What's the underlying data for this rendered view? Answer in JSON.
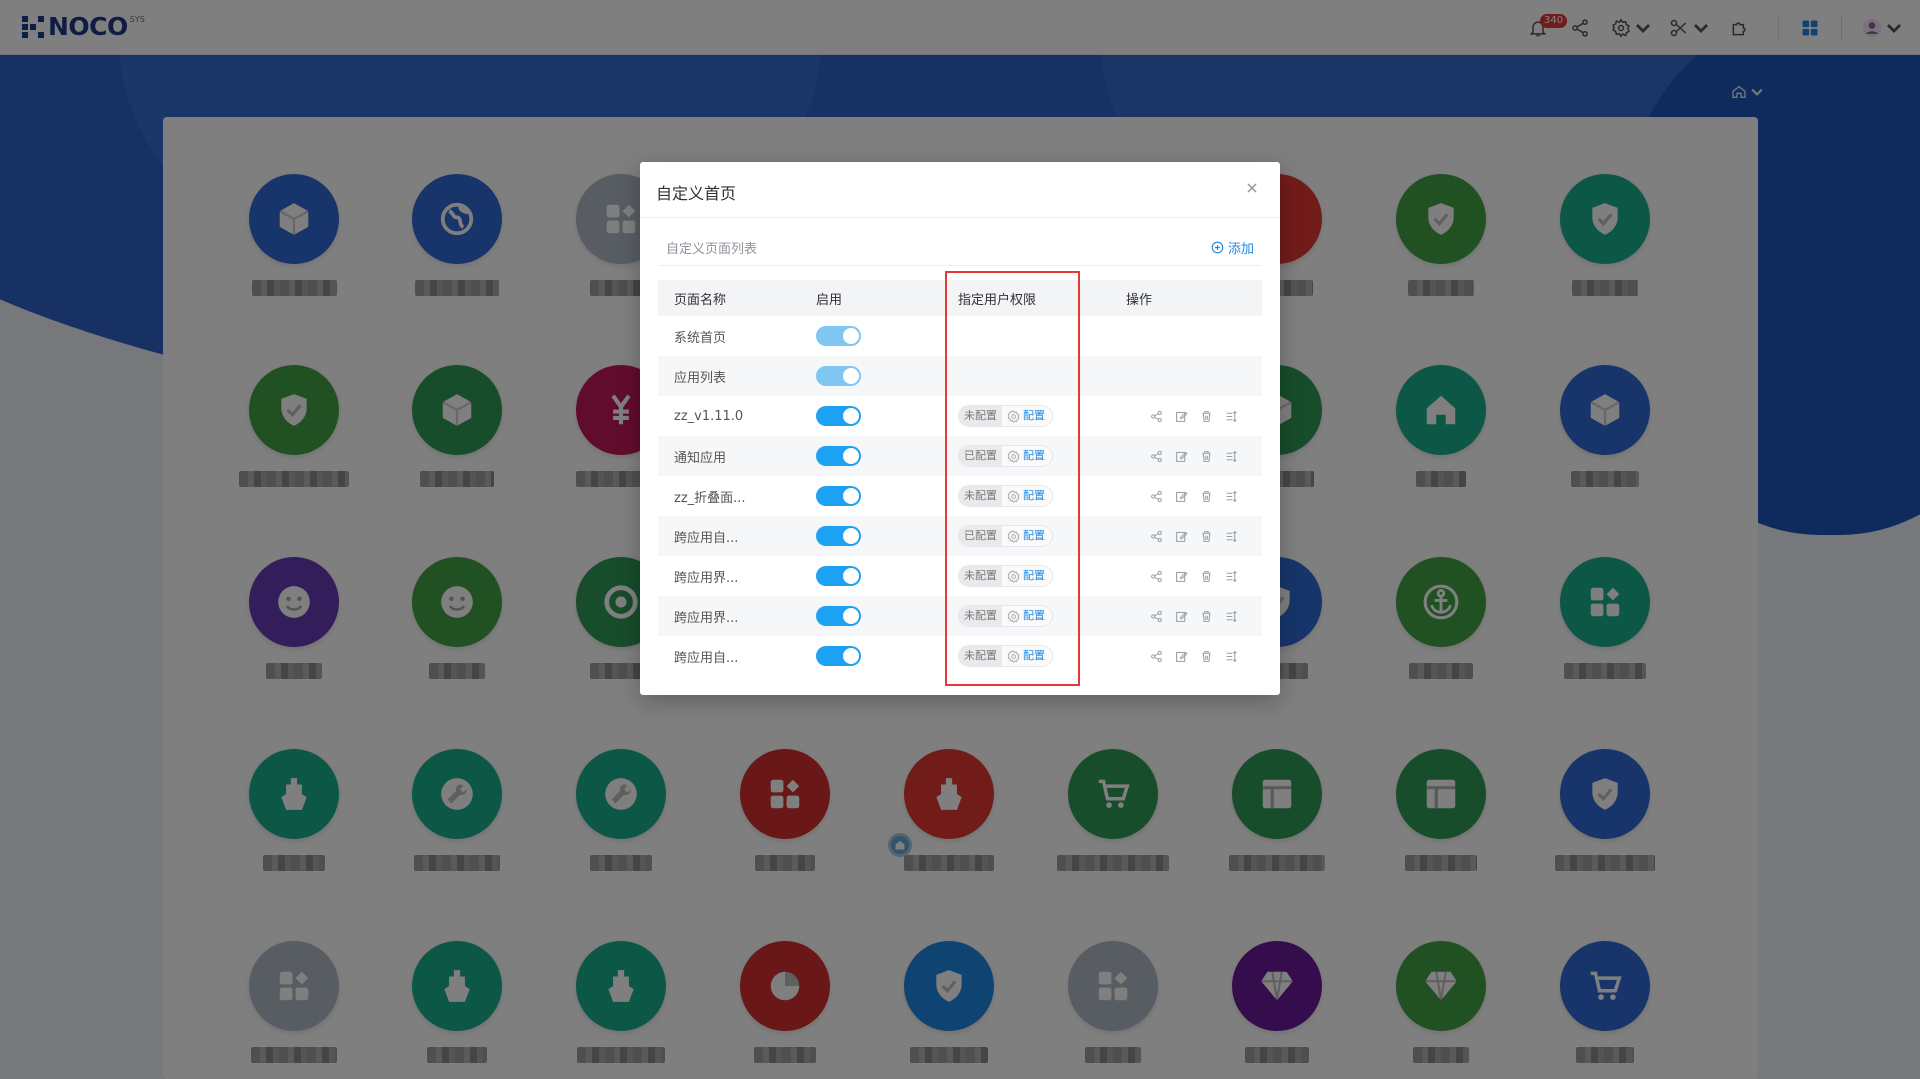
{
  "brand": {
    "name": "NOCO",
    "sup": "SYS"
  },
  "topbar": {
    "notification_count": "340"
  },
  "modal": {
    "title": "自定义首页",
    "section_title": "自定义页面列表",
    "add_label": "添加",
    "columns": [
      "页面名称",
      "启用",
      "指定用户权限",
      "操作"
    ],
    "config_label": "配置",
    "rows": [
      {
        "name": "系统首页",
        "enabled": true,
        "permission": null
      },
      {
        "name": "应用列表",
        "enabled": true,
        "permission": null
      },
      {
        "name": "zz_v1.11.0",
        "enabled": true,
        "permission": "未配置"
      },
      {
        "name": "通知应用",
        "enabled": true,
        "permission": "已配置"
      },
      {
        "name": "zz_折叠面...",
        "enabled": true,
        "permission": "未配置"
      },
      {
        "name": "跨应用自...",
        "enabled": true,
        "permission": "已配置"
      },
      {
        "name": "跨应用界...",
        "enabled": true,
        "permission": "未配置"
      },
      {
        "name": "跨应用界...",
        "enabled": true,
        "permission": "未配置"
      },
      {
        "name": "跨应用自...",
        "enabled": true,
        "permission": "未配置"
      }
    ]
  },
  "apps": [
    {
      "icon": "cube-icon",
      "color": "#2e6bd6"
    },
    {
      "icon": "globe-icon",
      "color": "#2e6bd6"
    },
    {
      "icon": "apps-icon",
      "color": "#b0bac8"
    },
    {
      "icon": "",
      "color": "#2e6bd6"
    },
    {
      "icon": "",
      "color": "#2e6bd6"
    },
    {
      "icon": "",
      "color": "#2e6bd6"
    },
    {
      "icon": "",
      "color": "#e53935"
    },
    {
      "icon": "shield-check-icon",
      "color": "#43a047"
    },
    {
      "icon": "shield-check-icon",
      "color": "#1aaf8f"
    },
    {
      "icon": "shield-check-icon",
      "color": "#43a047"
    },
    {
      "icon": "cube-icon",
      "color": "#2e9a55"
    },
    {
      "icon": "yen-icon",
      "color": "#c2185b"
    },
    {
      "icon": "",
      "color": "#2e6bd6"
    },
    {
      "icon": "",
      "color": "#2e6bd6"
    },
    {
      "icon": "",
      "color": "#2e6bd6"
    },
    {
      "icon": "cube-icon",
      "color": "#2e9a55"
    },
    {
      "icon": "home-icon",
      "color": "#1aaf8f"
    },
    {
      "icon": "cube-icon",
      "color": "#2e6bd6"
    },
    {
      "icon": "smile-icon",
      "color": "#673ab7"
    },
    {
      "icon": "smile-icon",
      "color": "#43a047"
    },
    {
      "icon": "target-icon",
      "color": "#2e9a55"
    },
    {
      "icon": "",
      "color": "#2e6bd6"
    },
    {
      "icon": "",
      "color": "#2e6bd6"
    },
    {
      "icon": "",
      "color": "#2e6bd6"
    },
    {
      "icon": "shield-check-icon",
      "color": "#2e6bd6"
    },
    {
      "icon": "anchor-icon",
      "color": "#43a047"
    },
    {
      "icon": "apps-icon",
      "color": "#1aaf8f"
    },
    {
      "icon": "ship-icon",
      "color": "#1aaf8f"
    },
    {
      "icon": "wrench-icon",
      "color": "#1aaf8f"
    },
    {
      "icon": "wrench-icon",
      "color": "#1aaf8f"
    },
    {
      "icon": "apps-icon",
      "color": "#d32f2f"
    },
    {
      "icon": "ship-icon",
      "color": "#e53935"
    },
    {
      "icon": "cart-icon",
      "color": "#2e9a55"
    },
    {
      "icon": "layout-icon",
      "color": "#2e9a55"
    },
    {
      "icon": "layout-icon",
      "color": "#2e9a55"
    },
    {
      "icon": "shield-check-icon",
      "color": "#2e6bd6"
    },
    {
      "icon": "apps-icon",
      "color": "#b0bac8"
    },
    {
      "icon": "ship-icon",
      "color": "#1aaf8f"
    },
    {
      "icon": "ship-icon",
      "color": "#1aaf8f"
    },
    {
      "icon": "pie-icon",
      "color": "#d32f2f"
    },
    {
      "icon": "shield-check-icon",
      "color": "#1e88e5"
    },
    {
      "icon": "apps-icon",
      "color": "#b0bac8"
    },
    {
      "icon": "diamond-icon",
      "color": "#6a1b9a"
    },
    {
      "icon": "diamond-icon",
      "color": "#43a047"
    },
    {
      "icon": "cart-icon",
      "color": "#2e6bd6"
    }
  ]
}
